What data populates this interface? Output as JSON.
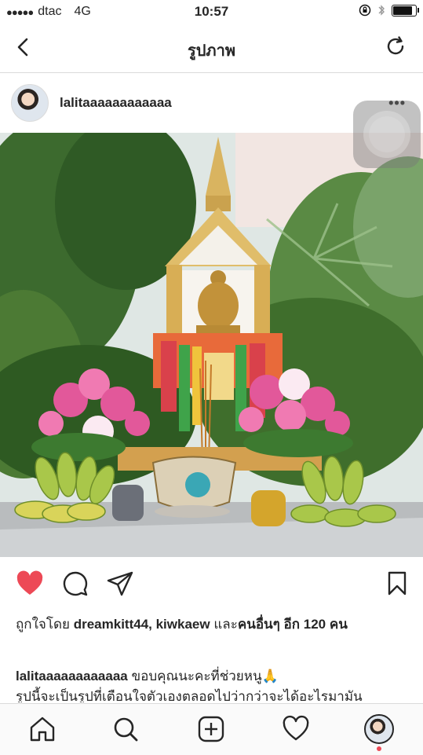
{
  "status_bar": {
    "signal": "●●●●●",
    "carrier": "dtac",
    "network": "4G",
    "time": "10:57"
  },
  "nav": {
    "title": "รูปภาพ"
  },
  "post": {
    "username": "lalitaaaaaaaaaaaa",
    "more_label": "•••",
    "liked_by_prefix": "ถูกใจโดย",
    "liked_by_names": "dreamkitt44, kiwkaew",
    "liked_by_and": "และ",
    "liked_by_others": "คนอื่นๆ",
    "liked_by_count": "อีก 120 คน",
    "caption_user": "lalitaaaaaaaaaaaa",
    "caption_text": "ขอบคุณนะคะที่ช่วยหนู🙏",
    "caption_line2": "รูปนี้จะเป็นรูปที่เตือนใจตัวเองตลอดไปว่ากว่าจะได้อะไรมามัน"
  },
  "colors": {
    "like_red": "#ed4956",
    "text": "#262626",
    "divider": "#dbdbdb"
  },
  "icons": {
    "back": "chevron-left-icon",
    "refresh": "refresh-icon",
    "like": "heart-filled-icon",
    "comment": "comment-icon",
    "share": "paper-plane-icon",
    "save": "bookmark-icon",
    "tab_home": "home-icon",
    "tab_search": "search-icon",
    "tab_add": "add-icon",
    "tab_activity": "heart-icon",
    "tab_profile": "profile-avatar"
  }
}
